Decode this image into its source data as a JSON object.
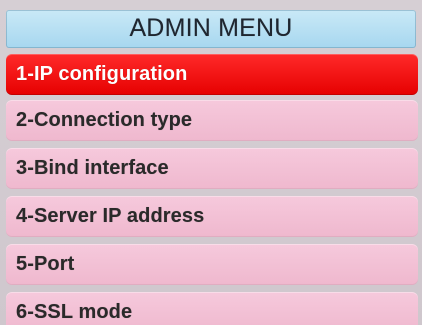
{
  "header": {
    "title": "ADMIN MENU"
  },
  "menu": {
    "selected_index": 0,
    "items": [
      {
        "label": "1-IP configuration"
      },
      {
        "label": "2-Connection type"
      },
      {
        "label": "3-Bind interface"
      },
      {
        "label": "4-Server IP address"
      },
      {
        "label": "5-Port"
      },
      {
        "label": "6-SSL mode"
      }
    ]
  },
  "colors": {
    "header_bg": "#b7e0f4",
    "item_bg": "#f2c0d5",
    "selected_bg": "#f00000",
    "selected_text": "#ffffff",
    "text": "#2a2a2a"
  }
}
